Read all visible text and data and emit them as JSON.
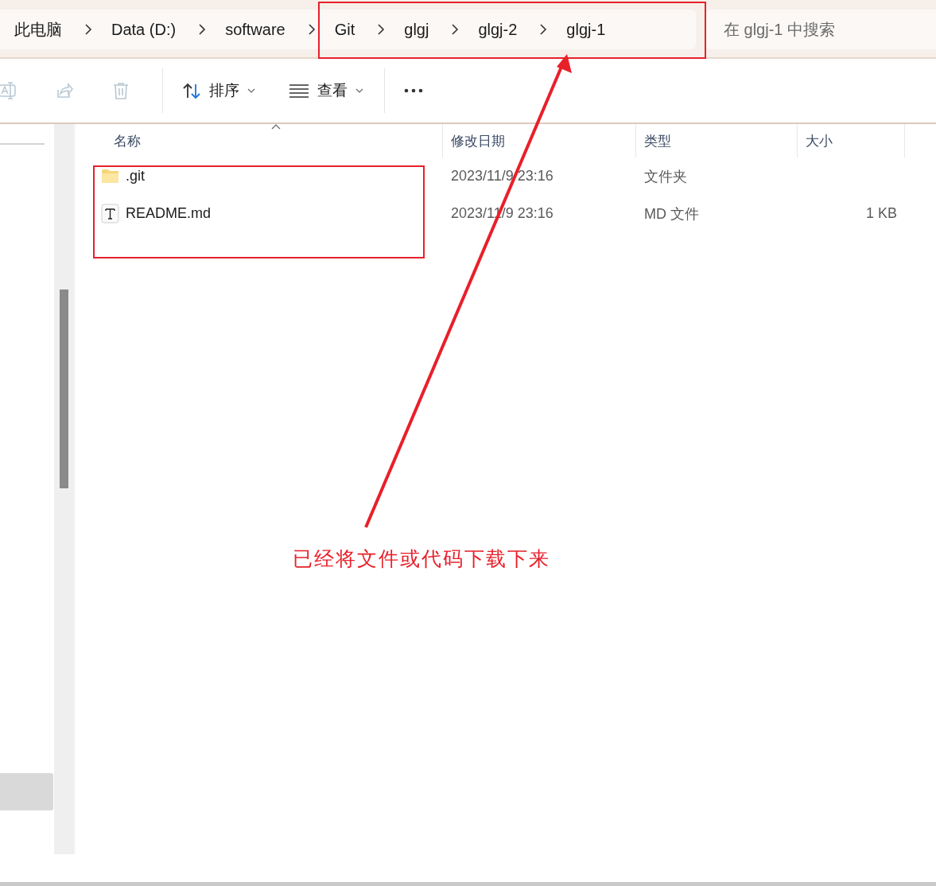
{
  "breadcrumb": [
    {
      "label": "此电脑"
    },
    {
      "label": "Data (D:)"
    },
    {
      "label": "software"
    },
    {
      "label": "Git"
    },
    {
      "label": "glgj"
    },
    {
      "label": "glgj-2"
    },
    {
      "label": "glgj-1"
    }
  ],
  "search": {
    "placeholder": "在 glgj-1 中搜索"
  },
  "toolbar": [
    {
      "kind": "rename",
      "disabled": true
    },
    {
      "kind": "share",
      "disabled": true
    },
    {
      "kind": "delete",
      "disabled": true
    },
    {
      "kind": "sort",
      "label": "排序",
      "disabled": false
    },
    {
      "kind": "view",
      "label": "查看",
      "disabled": false
    },
    {
      "kind": "more",
      "disabled": false
    }
  ],
  "columns": [
    {
      "label": "名称"
    },
    {
      "label": "修改日期"
    },
    {
      "label": "类型"
    },
    {
      "label": "大小"
    }
  ],
  "rows": [
    {
      "kind": "folder",
      "name": ".git",
      "modified": "2023/11/9 23:16",
      "type": "文件夹"
    },
    {
      "kind": "text",
      "name": "README.md",
      "modified": "2023/11/9 23:16",
      "type": "MD 文件",
      "size": "1 KB"
    }
  ],
  "annotation": {
    "text": "已经将文件或代码下载下来"
  }
}
